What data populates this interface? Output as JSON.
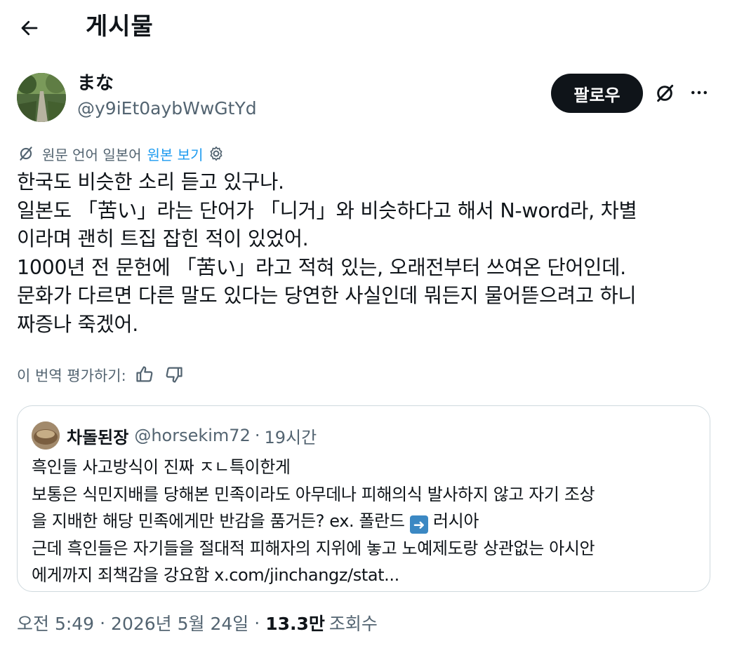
{
  "header": {
    "title": "게시물"
  },
  "author": {
    "display_name": "まな",
    "handle": "@y9iEt0aybWwGtYd",
    "follow_label": "팔로우"
  },
  "translation": {
    "note": "원문 언어 일본어",
    "show_original": "원본 보기"
  },
  "tweet": {
    "text": "한국도 비슷한 소리 듣고 있구나.\n일본도 「苦い」라는 단어가 「니거」와 비슷하다고 해서 N-word라, 차별\n이라며 괜히 트집 잡힌 적이 있었어.\n1000년 전 문헌에 「苦い」라고 적혀 있는, 오래전부터 쓰여온 단어인데.\n문화가 다르면 다른 말도 있다는 당연한 사실인데 뭐든지 물어뜯으려고 하니\n짜증나 죽겠어."
  },
  "rating": {
    "label": "이 번역 평가하기:"
  },
  "quote": {
    "display_name": "차돌된장",
    "handle": "@horsekim72",
    "separator": "·",
    "time": "19시간",
    "line1": "흑인들 사고방식이 진짜 ㅈㄴ특이한게",
    "line2": "보통은 식민지배를 당해본 민족이라도 아무데나 피해의식 발사하지 않고 자기 조상",
    "line3a": "을 지배한 해당 민족에게만 반감을 품거든? ex. 폴란드 ",
    "line3b": " 러시아",
    "line4": "근데 흑인들은 자기들을 절대적 피해자의 지위에 놓고 노예제도랑 상관없는 아시안",
    "line5": "에게까지 죄책감을 강요함 x.com/jinchangz/stat..."
  },
  "meta": {
    "time": "오전 5:49",
    "separator": "·",
    "date": "2026년 5월 24일",
    "views_count": "13.3만",
    "views_label": "조회수"
  },
  "icons": {
    "back": "arrow-left-icon",
    "grok": "grok-icon",
    "more": "more-icon",
    "translate": "grok-icon",
    "settings": "gear-icon",
    "thumbs_up": "thumbs-up-icon",
    "thumbs_down": "thumbs-down-icon",
    "arrow_emoji": "right-arrow-emoji-icon"
  },
  "colors": {
    "text": "#0f1419",
    "secondary": "#536471",
    "link": "#1d9bf0",
    "border": "#cfd9de"
  }
}
